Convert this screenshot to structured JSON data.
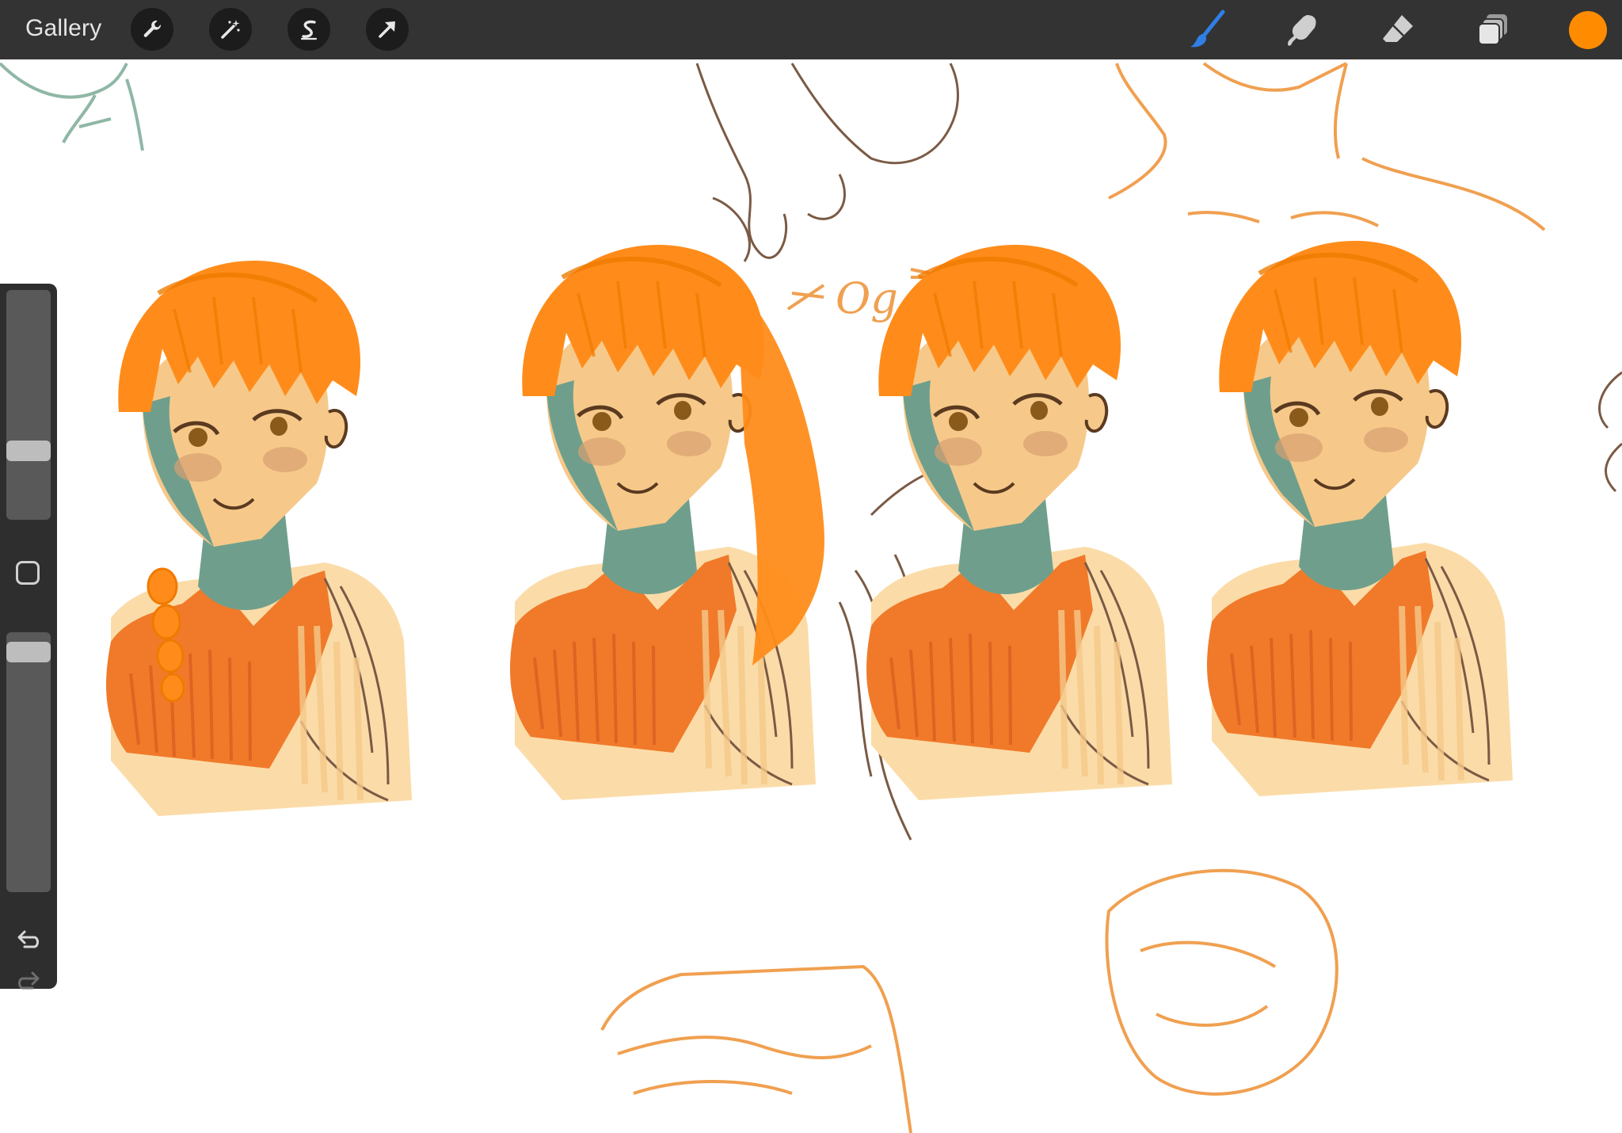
{
  "topbar": {
    "gallery_label": "Gallery",
    "left_tools": [
      {
        "name": "actions",
        "icon": "wrench-icon"
      },
      {
        "name": "adjustments",
        "icon": "magic-wand-icon"
      },
      {
        "name": "selection",
        "icon": "selection-s-icon"
      },
      {
        "name": "transform",
        "icon": "arrow-icon"
      }
    ],
    "right_tools": [
      {
        "name": "brush",
        "icon": "brush-icon",
        "active": true
      },
      {
        "name": "smudge",
        "icon": "smudge-icon"
      },
      {
        "name": "eraser",
        "icon": "eraser-icon"
      },
      {
        "name": "layers",
        "icon": "layers-icon"
      }
    ],
    "current_color": "#ff8c00",
    "active_tool_color": "#2f7fe6"
  },
  "sidebar": {
    "brush_size_level": 0.28,
    "opacity_level": 0.96,
    "icons": [
      "modify-square-icon",
      "undo-icon",
      "redo-icon"
    ]
  },
  "canvas": {
    "annotation_text": "Og",
    "palette": {
      "hair": "#ff8c1a",
      "hair_dark": "#f07a00",
      "skin": "#f6c98a",
      "skin_light": "#fbdca8",
      "shadow": "#6f9f8c",
      "top": "#f07a2a",
      "top_stripe": "#d85a1e",
      "sketch_brown": "#7a5a45",
      "sketch_orange": "#f0a050",
      "sketch_green": "#8fb7a5"
    }
  }
}
